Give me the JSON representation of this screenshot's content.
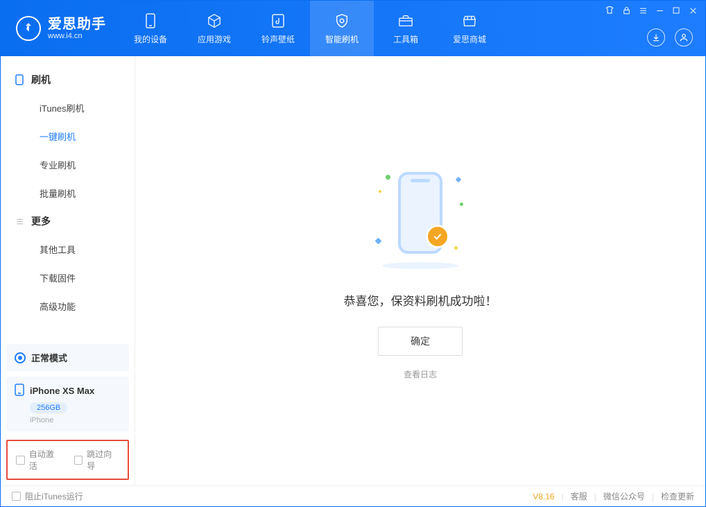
{
  "brand": {
    "name": "爱思助手",
    "domain": "www.i4.cn"
  },
  "tabs": [
    {
      "label": "我的设备"
    },
    {
      "label": "应用游戏"
    },
    {
      "label": "铃声壁纸"
    },
    {
      "label": "智能刷机"
    },
    {
      "label": "工具箱"
    },
    {
      "label": "爱思商城"
    }
  ],
  "sidebar": {
    "group1_title": "刷机",
    "items1": [
      {
        "label": "iTunes刷机"
      },
      {
        "label": "一键刷机"
      },
      {
        "label": "专业刷机"
      },
      {
        "label": "批量刷机"
      }
    ],
    "group2_title": "更多",
    "items2": [
      {
        "label": "其他工具"
      },
      {
        "label": "下载固件"
      },
      {
        "label": "高级功能"
      }
    ]
  },
  "status_card": {
    "label": "正常模式"
  },
  "device_card": {
    "name": "iPhone XS Max",
    "storage": "256GB",
    "type": "iPhone"
  },
  "options": {
    "auto_activate": "自动激活",
    "skip_guide": "跳过向导"
  },
  "main": {
    "success_text": "恭喜您，保资料刷机成功啦！",
    "ok_button": "确定",
    "view_log": "查看日志"
  },
  "footer": {
    "block_itunes": "阻止iTunes运行",
    "version": "V8.16",
    "support": "客服",
    "wechat": "微信公众号",
    "check_update": "检查更新"
  }
}
